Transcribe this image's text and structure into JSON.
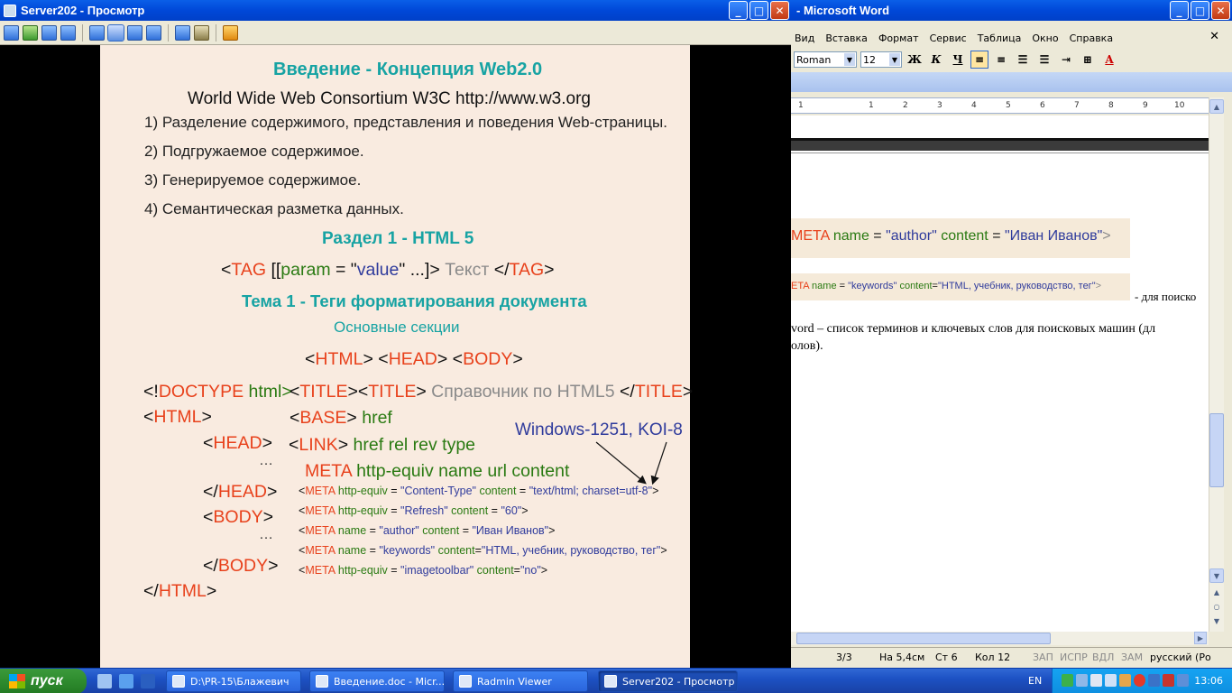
{
  "radmin": {
    "title": "Server202 - Просмотр"
  },
  "slide": {
    "title": "Введение - Концепция Web2.0",
    "consortium": "World Wide Web Consortium  W3C  http://www.w3.org",
    "points": [
      "1) Разделение содержимого, представления и поведения Web-страницы.",
      "2) Подгружаемое содержимое.",
      "3) Генерируемое содержимое.",
      "4) Семантическая разметка данных."
    ],
    "section": "Раздел 1 - HTML 5",
    "syntax": {
      "lt": "<",
      "tag": "TAG",
      "open": " [[",
      "param": "param",
      "eq": " = \"",
      "value": "value",
      "close": "\" ...]> ",
      "text": "Текст ",
      "end_lt": "</",
      "end_tag": "TAG",
      "gt": ">"
    },
    "topic": "Тема 1 - Теги форматирования документа",
    "subtitle": "Основные секции",
    "sections": {
      "html": "HTML",
      "head": "HEAD",
      "body": "BODY"
    },
    "code": {
      "doctype_pre": "<!",
      "doctype": "DOCTYPE",
      "doctype_post": " html>",
      "html_open": "HTML",
      "head_open": "HEAD",
      "dots1": "…",
      "head_close": "HEAD",
      "body_open": "BODY",
      "dots2": "…",
      "body_close": "BODY",
      "html_close": "HTML",
      "title1": "TITLE",
      "title2": "TITLE",
      "title_text": " Справочник по HTML5 ",
      "title3": "TITLE",
      "base": "BASE",
      "href1": " href",
      "link": "LINK",
      "link_attrs": " href  rel  rev  type",
      "meta": "META",
      "meta_attrs": "http-equiv  name  url  content",
      "charset_note": "Windows-1251, KOI-8"
    },
    "metas": [
      {
        "tag": "META",
        "a1": " http-equiv",
        "eq": " = ",
        "v1": "\"Content-Type\"",
        "a2": " content",
        "eq2": " = ",
        "v2": "\"text/html; charset=utf-8\""
      },
      {
        "tag": "META",
        "a1": " http-equiv",
        "eq": " = ",
        "v1": "\"Refresh\"",
        "a2": " content",
        "eq2": " = ",
        "v2": "\"60\""
      },
      {
        "tag": "META",
        "a1": " name",
        "eq": " = ",
        "v1": "\"author\"",
        "a2": " content",
        "eq2": " = ",
        "v2": "\"Иван Иванов\""
      },
      {
        "tag": "META",
        "a1": " name",
        "eq": " = ",
        "v1": "\"keywords\"",
        "a2": " content",
        "eq2": "=",
        "v2": "\"HTML, учебник, руководство, тег\""
      },
      {
        "tag": "META",
        "a1": " http-equiv",
        "eq": " = ",
        "v1": "\"imagetoolbar\"",
        "a2": " content",
        "eq2": "=",
        "v2": "\"no\""
      }
    ]
  },
  "word": {
    "title": "- Microsoft Word",
    "menu": [
      "Вид",
      "Вставка",
      "Формат",
      "Сервис",
      "Таблица",
      "Окно",
      "Справка"
    ],
    "font": "Roman",
    "size": "12",
    "bold": "Ж",
    "italic": "К",
    "underline": "Ч",
    "font_color": "A",
    "ruler": [
      "1",
      "1",
      "2",
      "3",
      "4",
      "5",
      "6",
      "7",
      "8",
      "9",
      "10"
    ],
    "img1": {
      "tag": "META",
      "a1": " name",
      "eq": " = ",
      "v1": "\"author\"",
      "a2": " content",
      "eq2": " = ",
      "v2": "\"Иван Иванов\"",
      "gt": ">"
    },
    "img2": {
      "tag": "ETA",
      "a1": " name",
      "eq": " = ",
      "v1": "\"keywords\"",
      "a2": " content",
      "eq2": "=",
      "v2": "\"HTML, учебник, руководство, тег\"",
      "gt": ">"
    },
    "after_img2": "- для поиско",
    "para_line1": "vord – список терминов и ключевых слов для поисковых машин (дл",
    "para_line2": "олов).",
    "status": {
      "page": "3/3",
      "at": "На 5,4см",
      "line": "Ст 6",
      "col": "Кол 12",
      "rec": "ЗАП",
      "trk": "ИСПР",
      "ext": "ВДЛ",
      "ovr": "ЗАМ",
      "lang": "русский (Ро"
    }
  },
  "taskbar": {
    "start": "пуск",
    "tasks": [
      "D:\\PR-15\\Блажевич",
      "Введение.doc - Micr...",
      "Radmin Viewer",
      "Server202 - Просмотр"
    ],
    "lang": "EN",
    "clock": "13:06"
  },
  "colors": {
    "accent": "#0a5fe8",
    "slide_bg": "#f9ebe0",
    "teal": "#17a3a3",
    "tag_red": "#e8411b",
    "attr_green": "#2a7a12",
    "value_blue": "#2f3b9c"
  }
}
